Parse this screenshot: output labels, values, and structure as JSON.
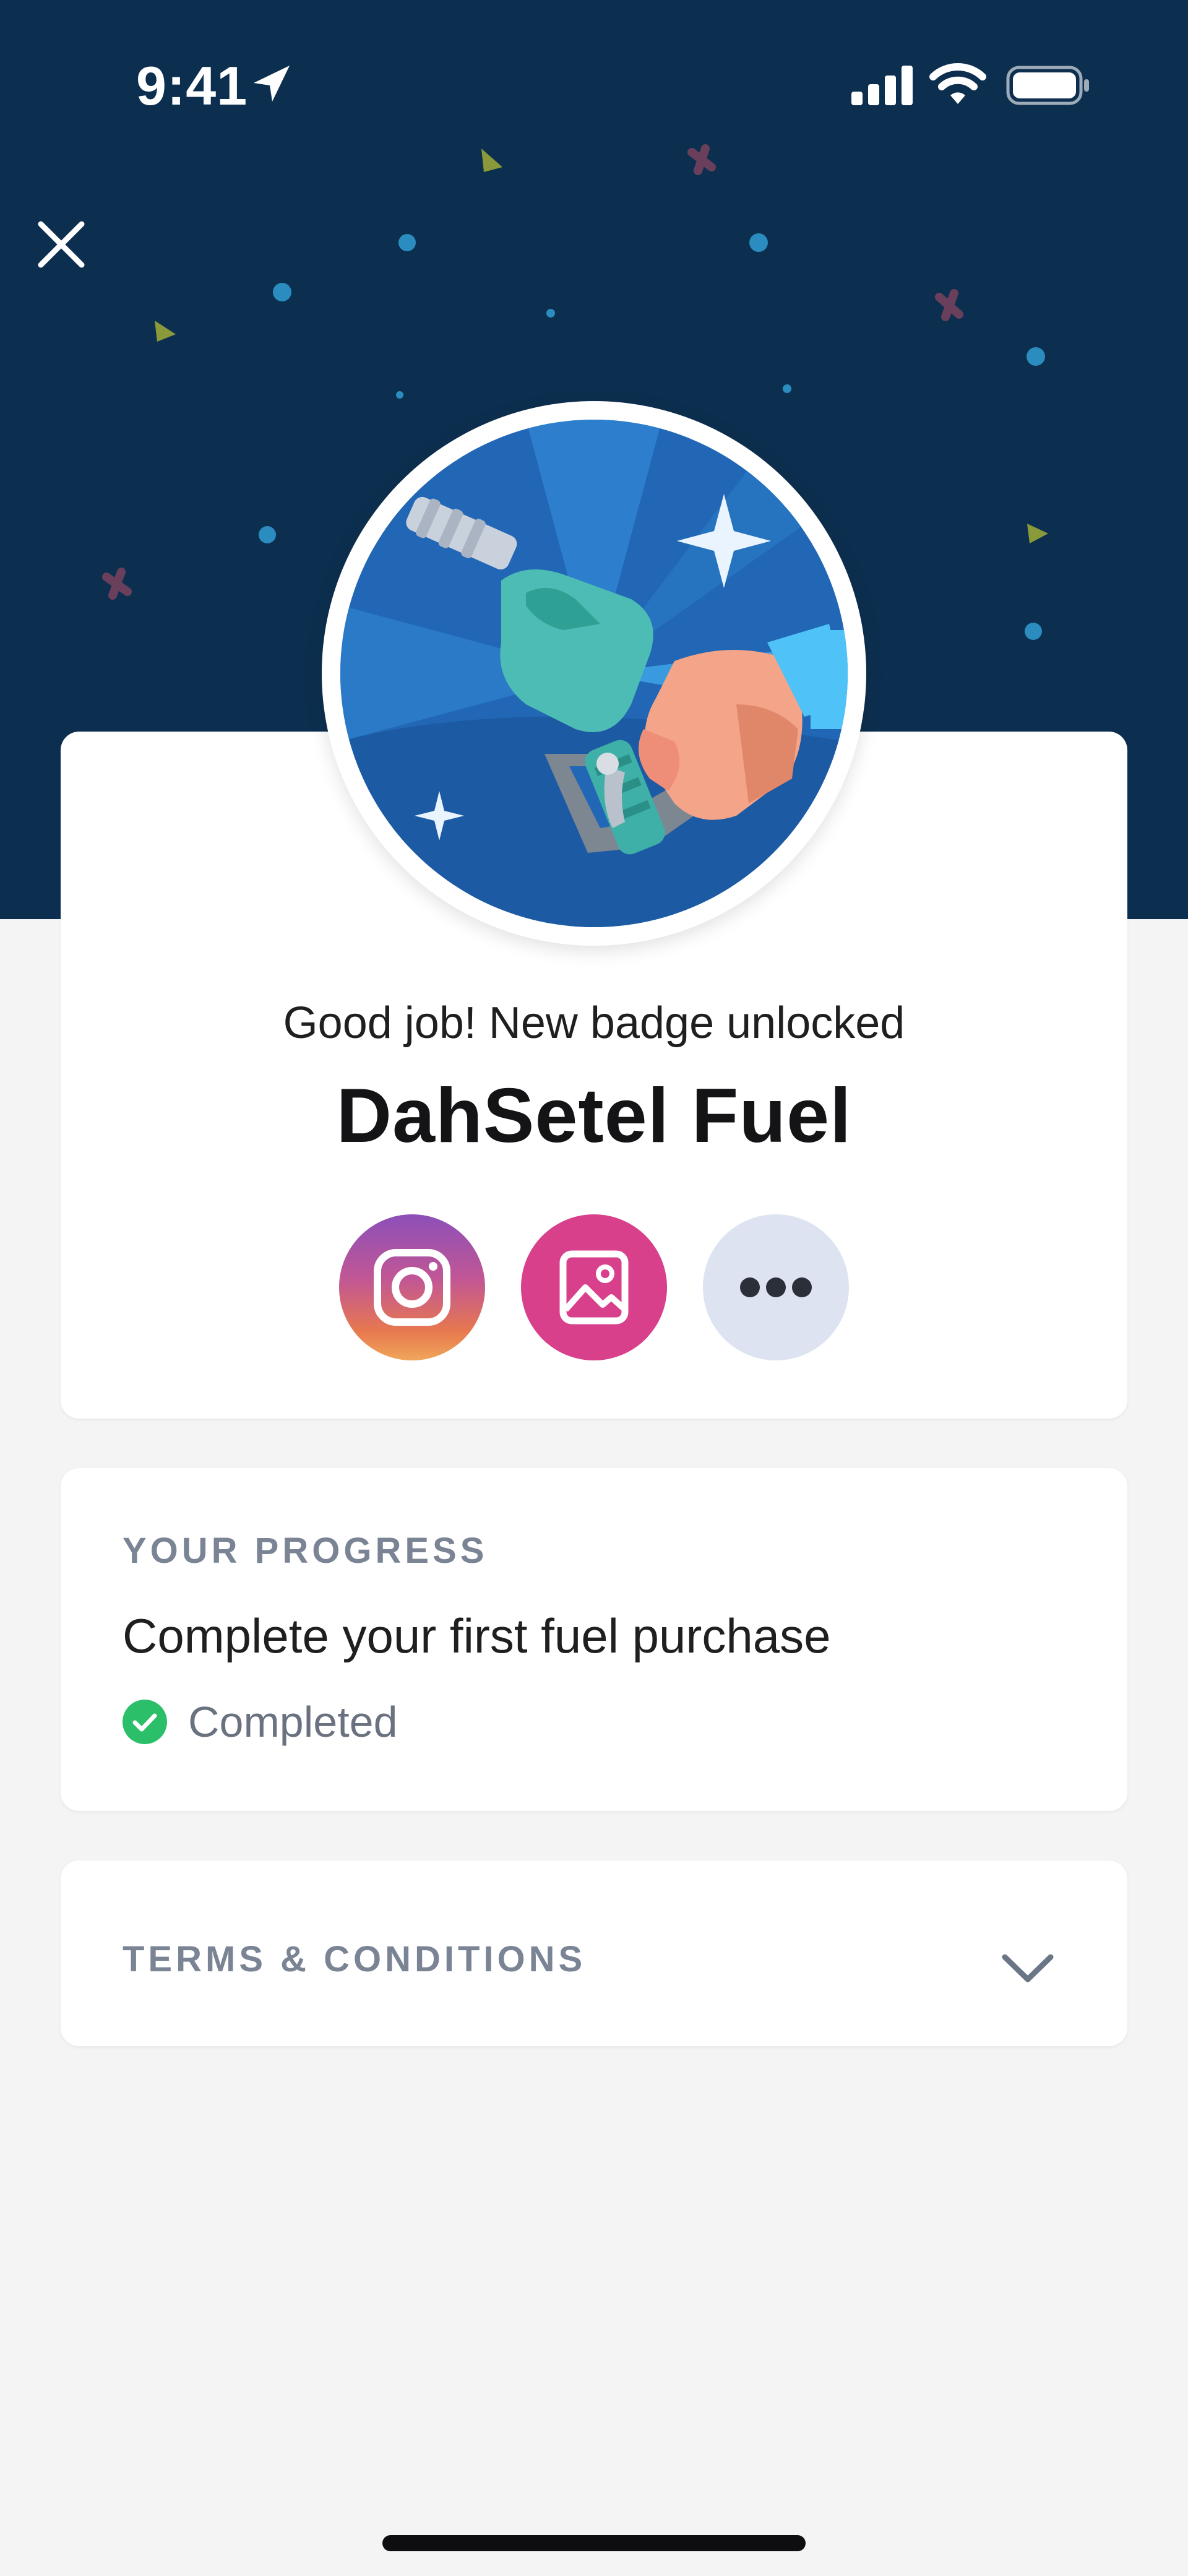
{
  "status_bar": {
    "time": "9:41"
  },
  "header": {
    "close_icon": "close-icon",
    "background_color": "#0d2f4f"
  },
  "badge": {
    "subtitle": "Good job! New badge unlocked",
    "title": "DahSetel Fuel",
    "illustration": "fuel-nozzle-in-hand"
  },
  "share": {
    "buttons": [
      {
        "icon": "instagram-icon"
      },
      {
        "icon": "image-icon"
      },
      {
        "icon": "more-icon"
      }
    ]
  },
  "progress": {
    "label": "YOUR PROGRESS",
    "task": "Complete your first fuel purchase",
    "status": "Completed",
    "status_color": "#2bbf6a"
  },
  "terms": {
    "label": "TERMS & CONDITIONS"
  }
}
